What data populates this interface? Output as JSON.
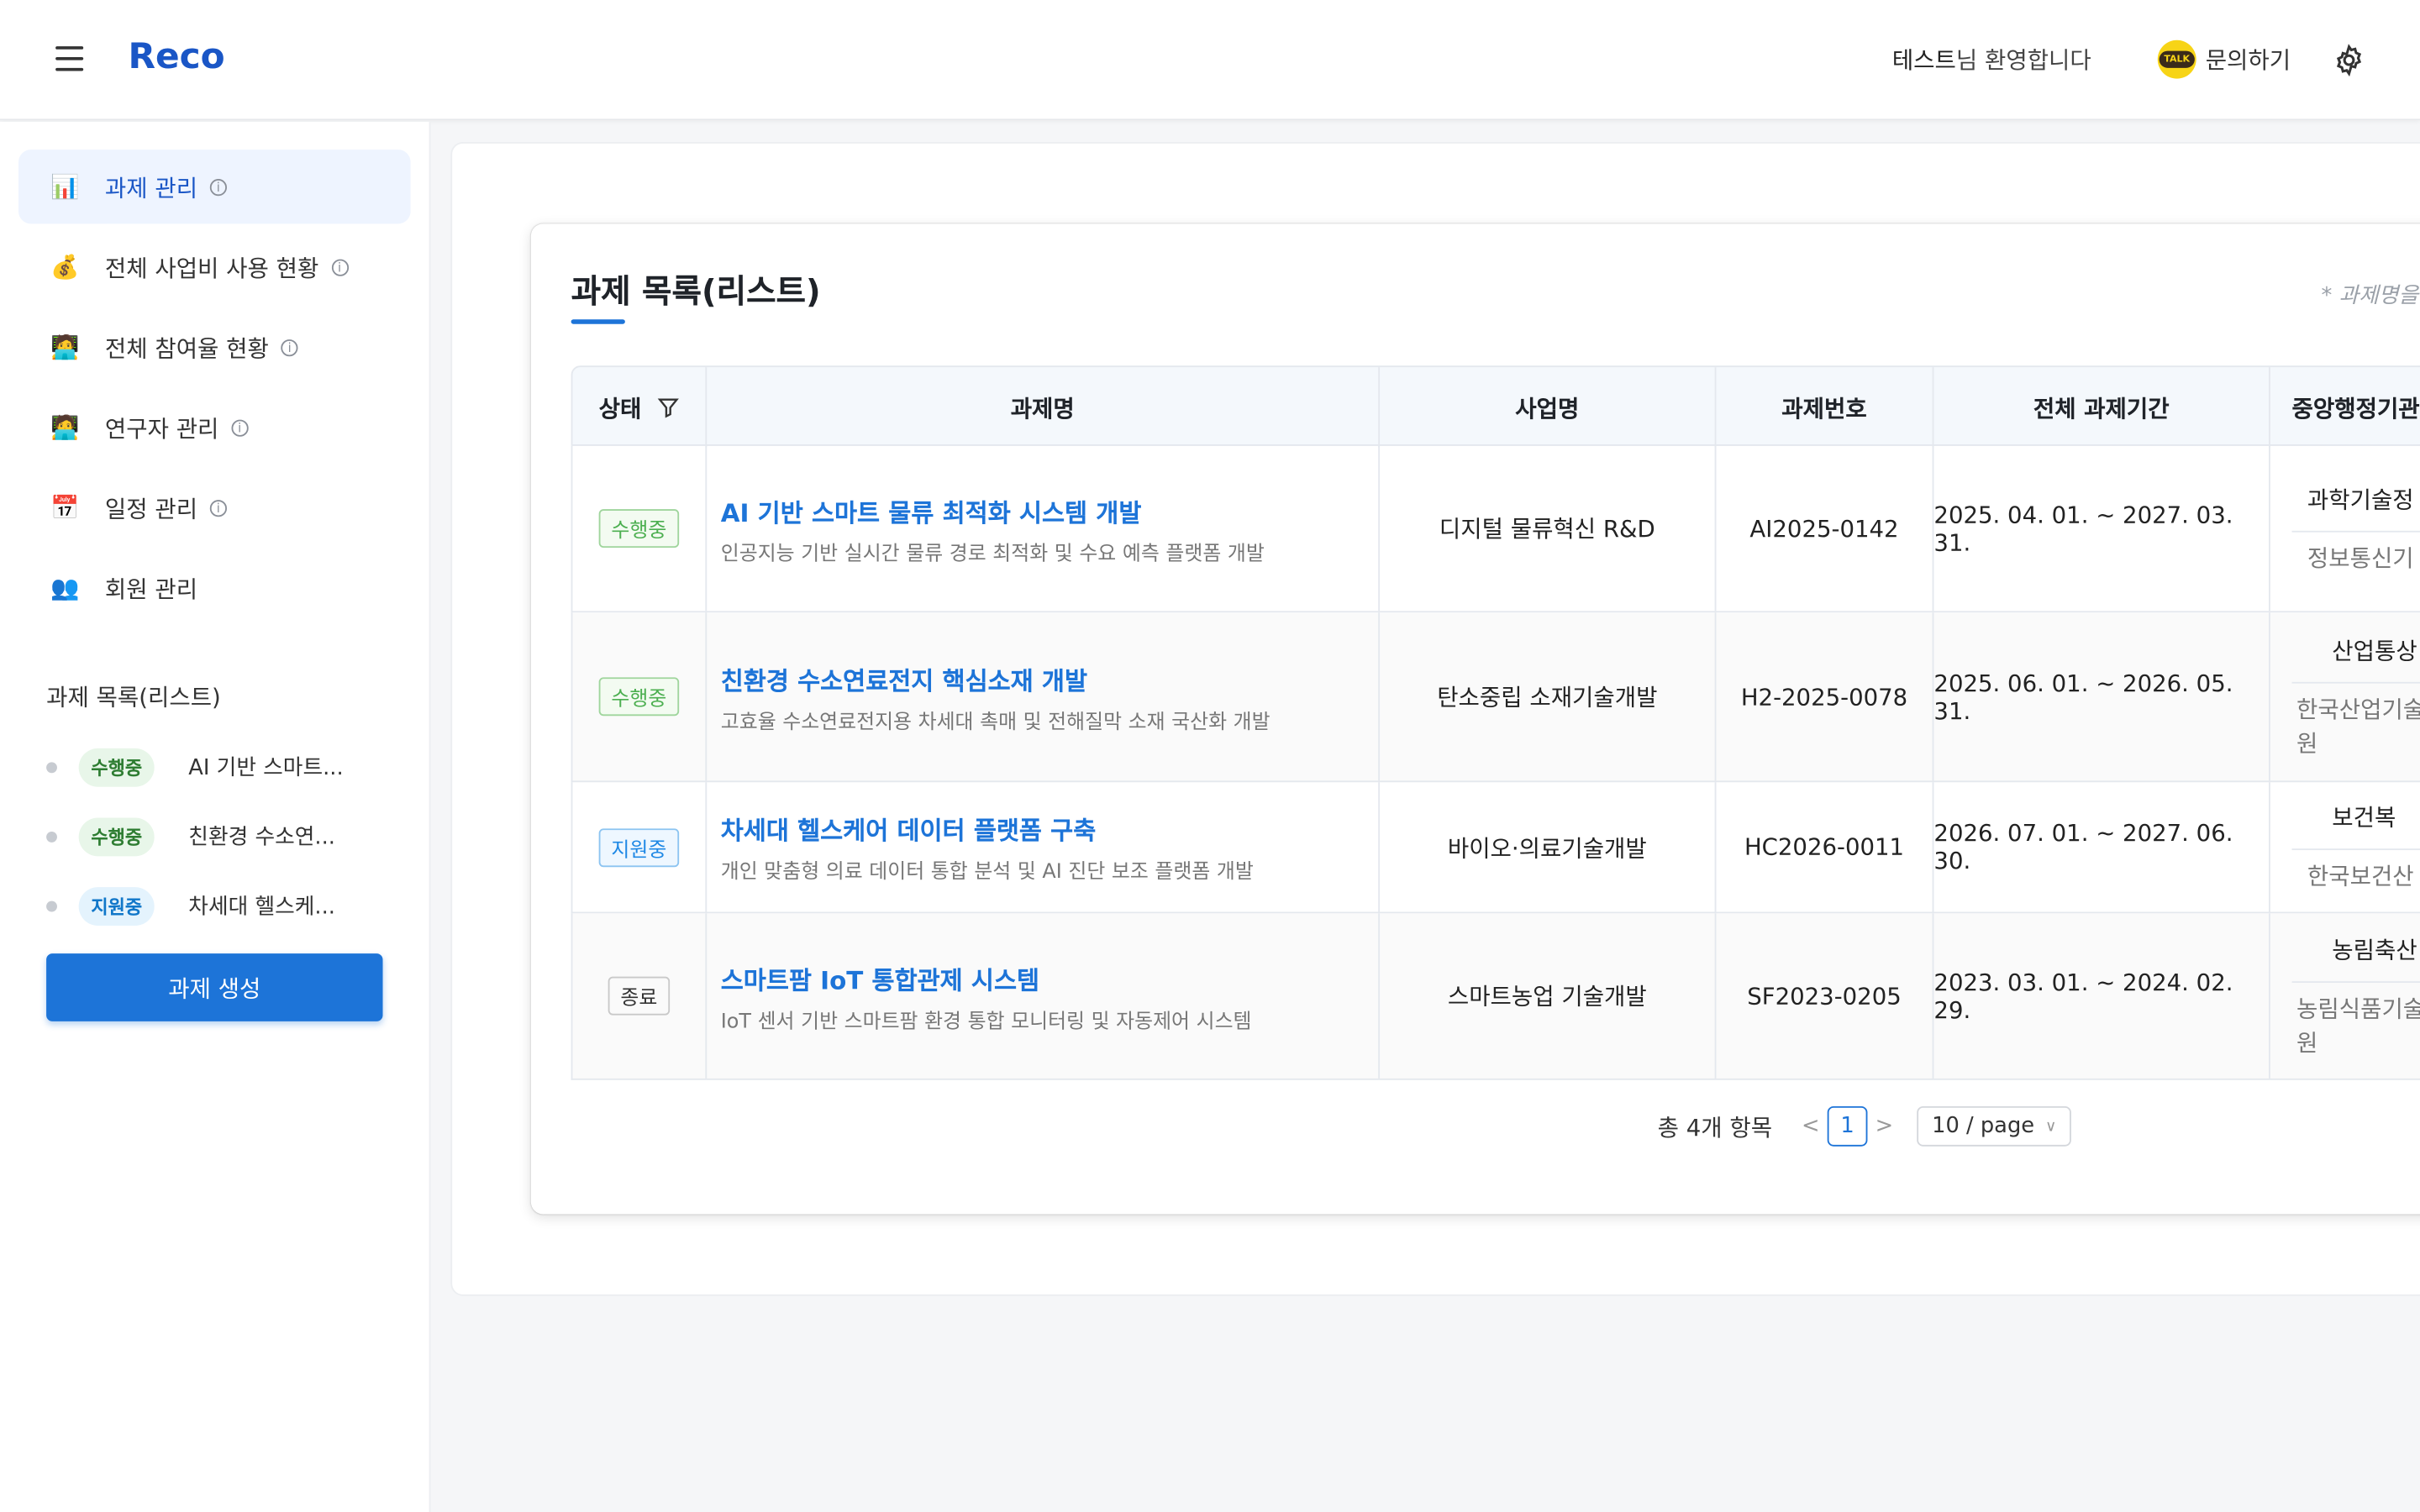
{
  "header": {
    "logo": "Reco",
    "welcome_name": "테스트",
    "welcome_suffix": "님 환영합니다",
    "inquiry": "문의하기",
    "talk_badge": "TALK"
  },
  "sidebar": {
    "items": [
      {
        "emoji": "📊",
        "label": "과제 관리",
        "info": true
      },
      {
        "emoji": "💰",
        "label": "전체 사업비 사용 현황",
        "info": true
      },
      {
        "emoji": "🧑‍💻",
        "label": "전체 참여율 현황",
        "info": true
      },
      {
        "emoji": "🧑‍💻",
        "label": "연구자 관리",
        "info": true
      },
      {
        "emoji": "📅",
        "label": "일정 관리",
        "info": true
      },
      {
        "emoji": "👥",
        "label": "회원 관리",
        "info": false
      }
    ],
    "section_title": "과제 목록(리스트)",
    "projects": [
      {
        "badge": "수행중",
        "name": "AI 기반 스마트..."
      },
      {
        "badge": "수행중",
        "name": "친환경 수소연..."
      },
      {
        "badge": "지원중",
        "name": "차세대 헬스케..."
      }
    ],
    "create_button": "과제 생성"
  },
  "main": {
    "title": "과제 목록(리스트)",
    "note": "* 과제명을",
    "columns": [
      "상태",
      "과제명",
      "사업명",
      "과제번호",
      "전체 과제기간",
      "중앙행정기관"
    ],
    "rows": [
      {
        "status": "수행중",
        "title": "AI 기반 스마트 물류 최적화 시스템 개발",
        "desc": "인공지능 기반 실시간 물류 경로 최적화 및 수요 예측 플랫폼 개발",
        "business": "디지털 물류혁신 R&D",
        "number": "AI2025-0142",
        "period": "2025. 04. 01. ~ 2027. 03. 31.",
        "agency_top": "과학기술정",
        "agency_bot": "정보통신기"
      },
      {
        "status": "수행중",
        "title": "친환경 수소연료전지 핵심소재 개발",
        "desc": "고효율 수소연료전지용 차세대 촉매 및 전해질막 소재 국산화 개발",
        "business": "탄소중립 소재기술개발",
        "number": "H2-2025-0078",
        "period": "2025. 06. 01. ~ 2026. 05. 31.",
        "agency_top": "산업통상",
        "agency_bot": "한국산업기술\n원"
      },
      {
        "status": "지원중",
        "title": "차세대 헬스케어 데이터 플랫폼 구축",
        "desc": "개인 맞춤형 의료 데이터 통합 분석 및 AI 진단 보조 플랫폼 개발",
        "business": "바이오·의료기술개발",
        "number": "HC2026-0011",
        "period": "2026. 07. 01. ~ 2027. 06. 30.",
        "agency_top": "보건복",
        "agency_bot": "한국보건산"
      },
      {
        "status": "종료",
        "title": "스마트팜 IoT 통합관제 시스템",
        "desc": "IoT 센서 기반 스마트팜 환경 통합 모니터링 및 자동제어 시스템",
        "business": "스마트농업 기술개발",
        "number": "SF2023-0205",
        "period": "2023. 03. 01. ~ 2024. 02. 29.",
        "agency_top": "농림축산",
        "agency_bot": "농림식품기술\n원"
      }
    ],
    "pagination": {
      "total": "총 4개 항목",
      "current": "1",
      "page_size": "10 / page"
    }
  }
}
